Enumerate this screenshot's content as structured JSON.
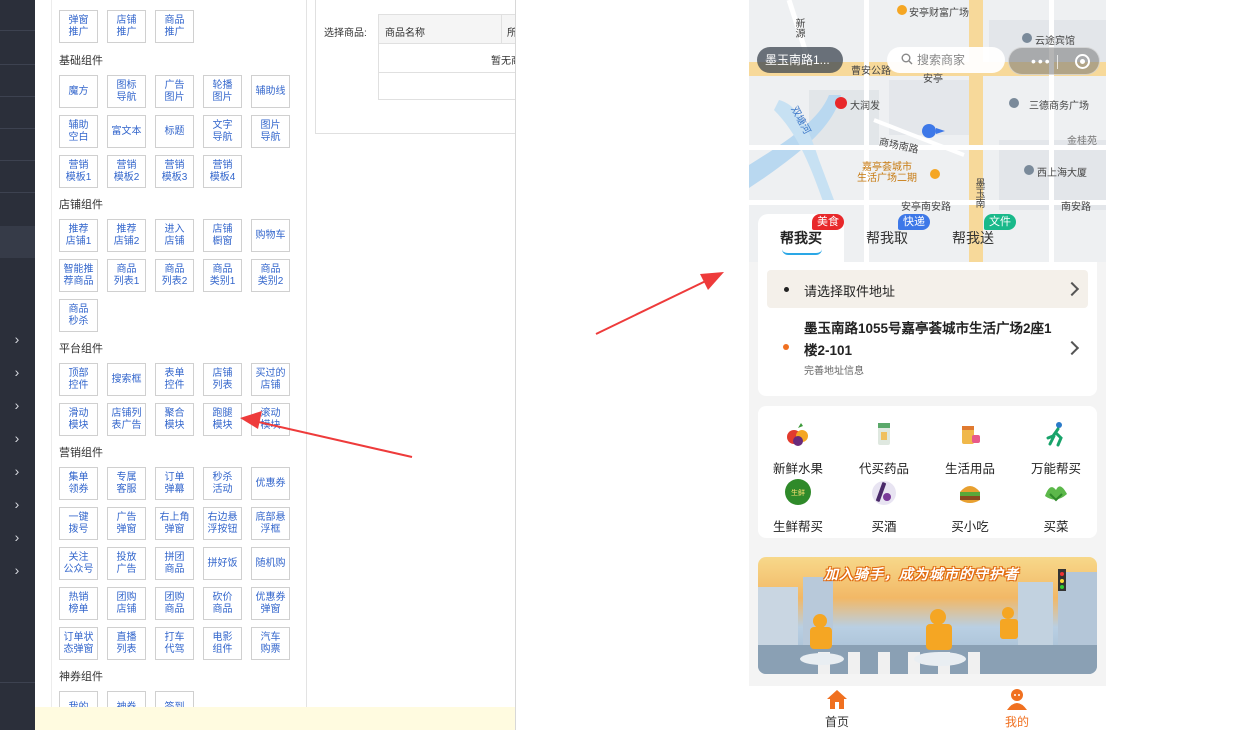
{
  "rail": {
    "expandable_items": 8
  },
  "panel": {
    "top_buttons": [
      "弹窗\n推广",
      "店铺\n推广",
      "商品\n推广"
    ],
    "sections": [
      {
        "title": "基础组件",
        "buttons": [
          "魔方",
          "图标\n导航",
          "广告\n图片",
          "轮播\n图片",
          "辅助线",
          "辅助\n空白",
          "富文本",
          "标题",
          "文字\n导航",
          "图片\n导航",
          "营销\n模板1",
          "营销\n模板2",
          "营销\n模板3",
          "营销\n模板4"
        ]
      },
      {
        "title": "店铺组件",
        "buttons": [
          "推荐\n店铺1",
          "推荐\n店铺2",
          "进入\n店铺",
          "店铺\n橱窗",
          "购物车",
          "智能推\n荐商品",
          "商品\n列表1",
          "商品\n列表2",
          "商品\n类别1",
          "商品\n类别2",
          "商品\n秒杀"
        ]
      },
      {
        "title": "平台组件",
        "buttons": [
          "顶部\n控件",
          "搜索框",
          "表单\n控件",
          "店铺\n列表",
          "买过的\n店铺",
          "滑动\n模块",
          "店铺列\n表广告",
          "聚合\n模块",
          "跑腿\n模块",
          "滚动\n模块"
        ]
      },
      {
        "title": "营销组件",
        "buttons": [
          "集单\n领券",
          "专属\n客服",
          "订单\n弹幕",
          "秒杀\n活动",
          "优惠券",
          "一键\n拨号",
          "广告\n弹窗",
          "右上角\n弹窗",
          "右边悬\n浮按钮",
          "底部悬\n浮框",
          "关注\n公众号",
          "投放\n广告",
          "拼团\n商品",
          "拼好饭",
          "随机购",
          "热销\n榜单",
          "团购\n店铺",
          "团购\n商品",
          "砍价\n商品",
          "优惠券\n弹窗",
          "订单状\n态弹窗",
          "直播\n列表",
          "打车\n代驾",
          "电影\n组件",
          "汽车\n购票"
        ]
      },
      {
        "title": "神券组件",
        "buttons": [
          "我的",
          "神券",
          "签到"
        ]
      }
    ]
  },
  "goods": {
    "label": "选择商品:",
    "col_name": "商品名称",
    "col_other": "所",
    "empty_text": "暂无商"
  },
  "phone": {
    "map_labels": {
      "anting_wealth": "安亭财富广场",
      "yunjin": "云途宾馆",
      "xinyuan": "新源",
      "caoan": "曹安公路",
      "anting": "安亭",
      "darunfa": "大润发",
      "sande": "三德商务广场",
      "jinguiyuan": "金桂苑",
      "shangchang_rd": "商场南路",
      "jiating": "嘉亭荟城市\n生活广场二期",
      "xishanghai": "西上海大厦",
      "anting_south": "安亭南安路",
      "moyu_south": "墨玉南",
      "nanan_rd": "南安路",
      "moyu_east": "双塘河"
    },
    "location": "墨玉南路1...",
    "search_placeholder": "搜索商家",
    "tabs": [
      {
        "label": "帮我买",
        "badge": "美食",
        "badge_color": "#e8282b"
      },
      {
        "label": "帮我取",
        "badge": "快递",
        "badge_color": "#3d78e8"
      },
      {
        "label": "帮我送",
        "badge": "文件",
        "badge_color": "#19b98a"
      }
    ],
    "pickup_label": "请选择取件地址",
    "dest_address": "墨玉南路1055号嘉亭荟城市生活广场2座1楼2-101",
    "dest_sub": "完善地址信息",
    "categories": [
      "新鲜水果",
      "代买药品",
      "生活用品",
      "万能帮买",
      "生鲜帮买",
      "买酒",
      "买小吃",
      "买菜"
    ],
    "banner_title": "加入骑手，成为城市的守护者",
    "tabbar": [
      {
        "label": "首页",
        "color": "#f07020"
      },
      {
        "label": "我的",
        "color": "#f07020"
      }
    ]
  },
  "colors": {
    "accent": "#f07020",
    "link": "#3366cc",
    "arrow": "#ee3b3b"
  }
}
